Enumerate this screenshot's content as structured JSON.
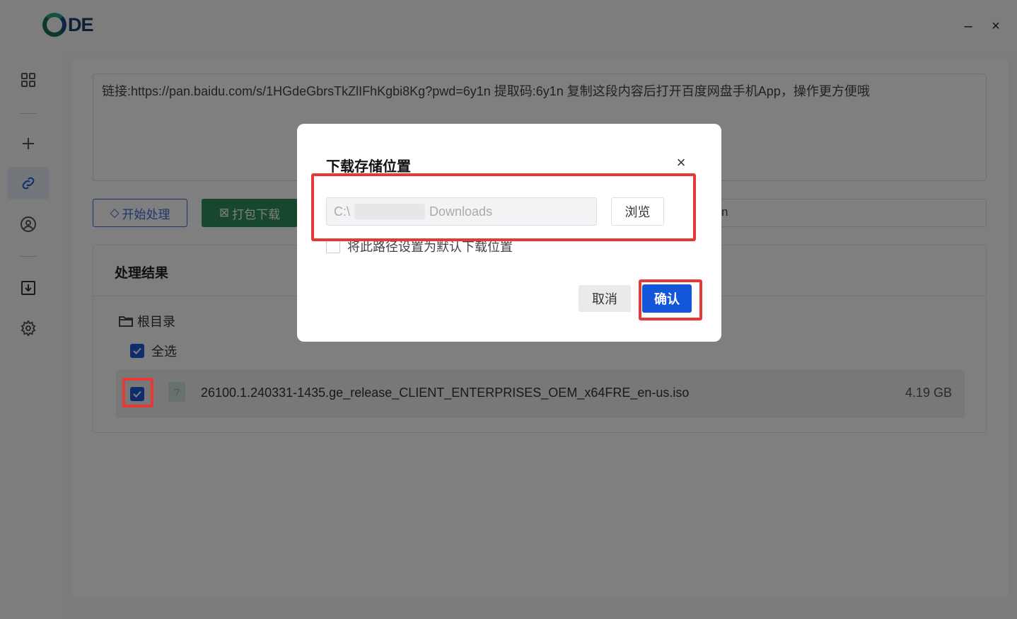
{
  "app": {
    "logo_text": "DE",
    "window": {
      "minimize": "–",
      "close": "×"
    }
  },
  "sidebar": {
    "items": [
      {
        "icon": "grid-icon"
      },
      {
        "icon": "plus-icon"
      },
      {
        "icon": "link-icon",
        "active": true
      },
      {
        "icon": "user-icon"
      },
      {
        "icon": "download-icon"
      },
      {
        "icon": "gear-icon"
      }
    ]
  },
  "main": {
    "link_text": "链接:https://pan.baidu.com/s/1HGdeGbrsTkZlIFhKgbi8Kg?pwd=6y1n 提取码:6y1n 复制这段内容后打开百度网盘手机App，操作更方便哦",
    "start_button": "开始处理",
    "pack_button": "打包下载",
    "path_field_partial": "n",
    "result_title": "处理结果",
    "tree_root": "根目录",
    "select_all": "全选",
    "file": {
      "name": "26100.1.240331-1435.ge_release_CLIENT_ENTERPRISES_OEM_x64FRE_en-us.iso",
      "size": "4.19 GB",
      "icon": "file-unknown-icon"
    }
  },
  "dialog": {
    "title": "下载存储位置",
    "close": "×",
    "path_prefix": "C:\\",
    "path_suffix": "Downloads",
    "browse_button": "浏览",
    "default_checkbox_label": "将此路径设置为默认下载位置",
    "cancel_button": "取消",
    "confirm_button": "确认"
  },
  "colors": {
    "accent": "#1356d9",
    "pack_green": "#2f8f5b",
    "annotation_red": "#e53935"
  }
}
